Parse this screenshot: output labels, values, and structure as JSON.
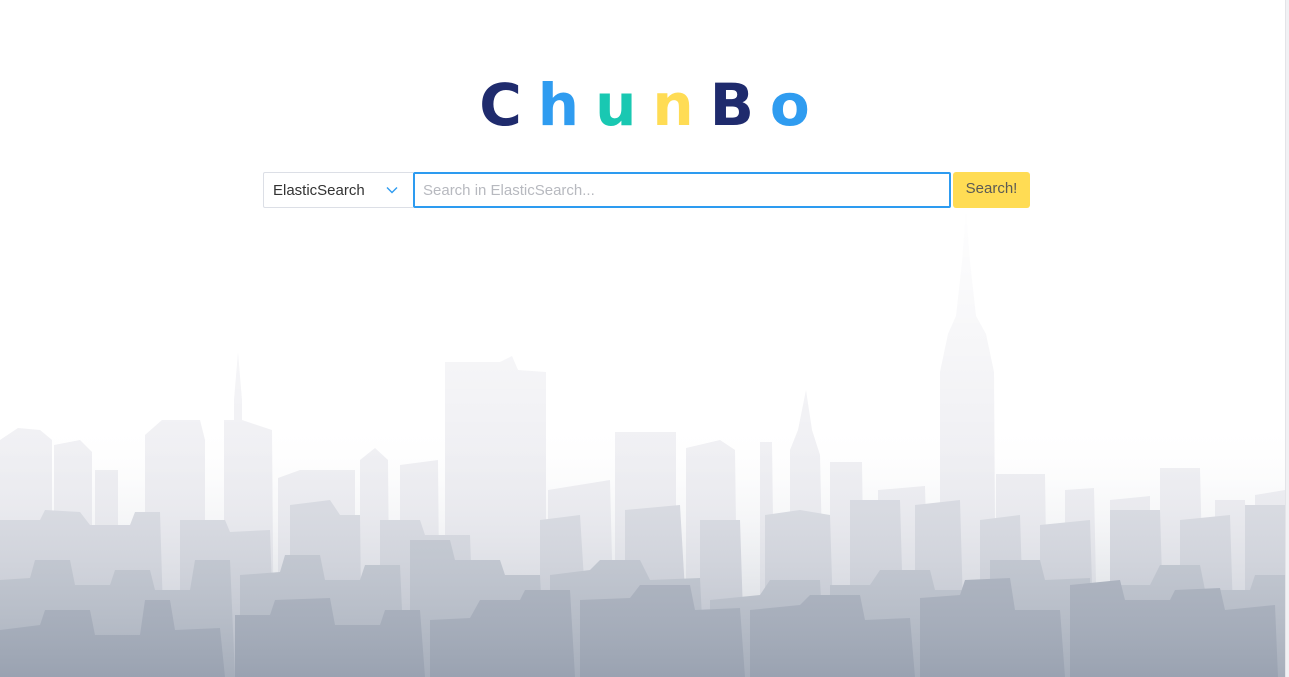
{
  "logo": {
    "letters": [
      {
        "char": "C",
        "color": "#1f2b6d"
      },
      {
        "char": "h",
        "color": "#2f9cf0"
      },
      {
        "char": "u",
        "color": "#19c8b2"
      },
      {
        "char": "n",
        "color": "#ffdc54"
      },
      {
        "char": "B",
        "color": "#1f2b6d"
      },
      {
        "char": "o",
        "color": "#2f9cf0"
      }
    ]
  },
  "search": {
    "engine_selected": "ElasticSearch",
    "engine_icon": "chevron-down-icon",
    "input_value": "",
    "placeholder": "Search in ElasticSearch...",
    "button_label": "Search!"
  },
  "colors": {
    "accent_blue": "#2d9bf0",
    "button_yellow": "#ffdc54",
    "skyline_light": "#eeeef2",
    "skyline_dark": "#9aa3b2"
  }
}
